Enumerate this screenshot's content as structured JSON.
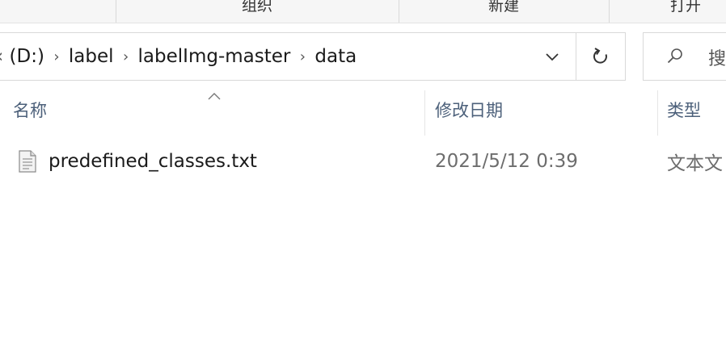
{
  "ribbon": {
    "groups": [
      {
        "label": "组织"
      },
      {
        "label": "新建"
      },
      {
        "label": "打开"
      }
    ]
  },
  "address": {
    "drive_partial": "(D:)",
    "drive_prefix_glyph": "‹",
    "crumbs": [
      "label",
      "labelImg-master",
      "data"
    ],
    "separator": "›"
  },
  "search": {
    "placeholder_partial": "搜"
  },
  "columns": {
    "name": "名称",
    "modified": "修改日期",
    "type": "类型"
  },
  "files": [
    {
      "name": "predefined_classes.txt",
      "modified": "2021/5/12 0:39",
      "type": "文本文"
    }
  ],
  "icons": {
    "dropdown": "chevron-down-icon",
    "refresh": "refresh-icon",
    "search": "search-icon",
    "sort": "sort-ascending-icon",
    "file": "text-file-icon"
  }
}
